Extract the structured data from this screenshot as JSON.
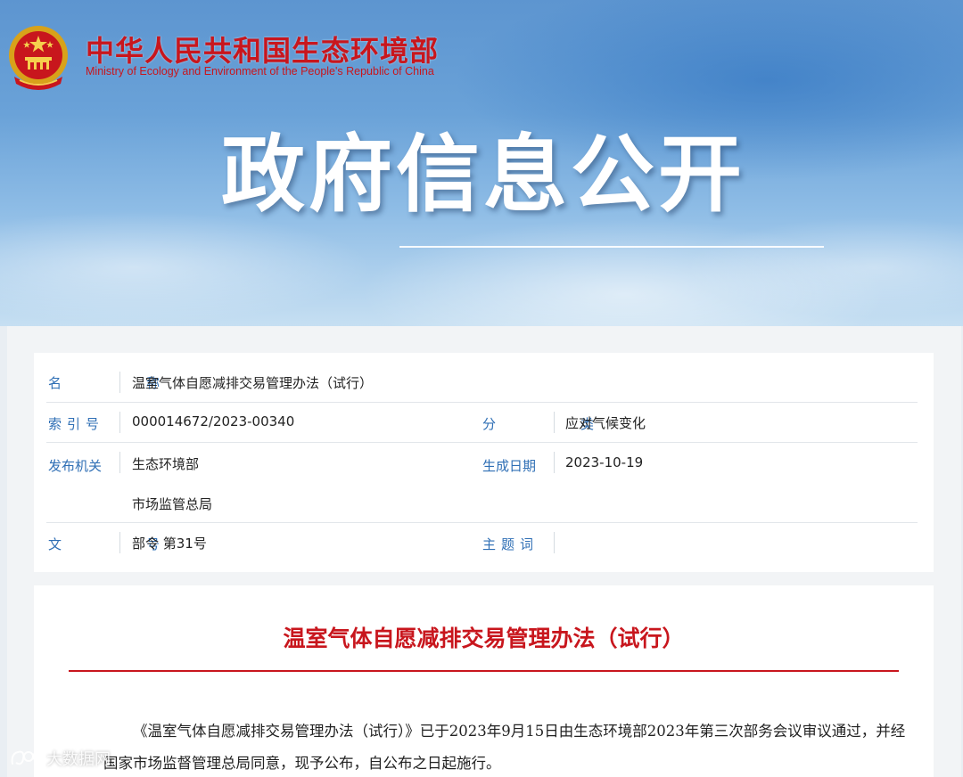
{
  "header": {
    "ministry_name_cn": "中华人民共和国生态环境部",
    "ministry_name_en": "Ministry of Ecology and Environment of the People's Republic of China",
    "banner_title": "政府信息公开"
  },
  "meta": {
    "name_label": "名　称",
    "name_value": "温室气体自愿减排交易管理办法（试行）",
    "index_label": "索引号",
    "index_value": "000014672/2023-00340",
    "category_label": "分　类",
    "category_value": "应对气候变化",
    "issuer_label": "发布机关",
    "issuer_values": [
      "生态环境部",
      "市场监管总局"
    ],
    "date_label": "生成日期",
    "date_value": "2023-10-19",
    "doc_no_label": "文　号",
    "doc_no_value": "部令 第31号",
    "keywords_label": "主题词",
    "keywords_value": ""
  },
  "document": {
    "title": "温室气体自愿减排交易管理办法（试行）",
    "paragraph": "《温室气体自愿减排交易管理办法（试行）》已于2023年9月15日由生态环境部2023年第三次部务会议审议通过，并经国家市场监督管理总局同意，现予公布，自公布之日起施行。"
  },
  "watermark": {
    "text": "大数据网"
  },
  "colors": {
    "brand_red": "#c8161d",
    "label_blue": "#2f6fb5"
  }
}
